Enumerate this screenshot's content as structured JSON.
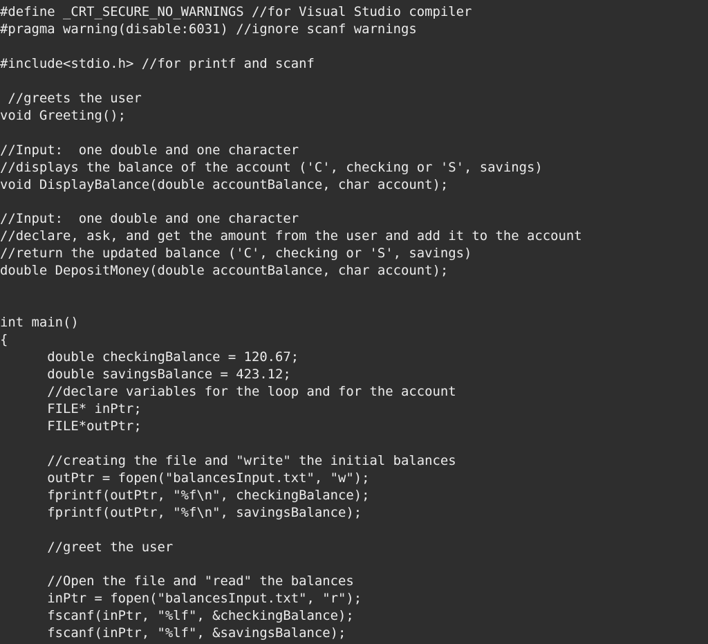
{
  "editor": {
    "background_color": "#2e2e2e",
    "text_color": "#ececec",
    "language": "c",
    "filename_hint": "main.c"
  },
  "code": {
    "full_text": "#define _CRT_SECURE_NO_WARNINGS //for Visual Studio compiler\n#pragma warning(disable:6031) //ignore scanf warnings\n\n#include<stdio.h> //for printf and scanf\n\n //greets the user\nvoid Greeting();\n\n//Input:  one double and one character\n//displays the balance of the account ('C', checking or 'S', savings)\nvoid DisplayBalance(double accountBalance, char account);\n\n//Input:  one double and one character\n//declare, ask, and get the amount from the user and add it to the account\n//return the updated balance ('C', checking or 'S', savings)\ndouble DepositMoney(double accountBalance, char account);\n\n\nint main()\n{\n      double checkingBalance = 120.67;\n      double savingsBalance = 423.12;\n      //declare variables for the loop and for the account\n      FILE* inPtr;\n      FILE*outPtr;\n\n      //creating the file and \"write\" the initial balances\n      outPtr = fopen(\"balancesInput.txt\", \"w\");\n      fprintf(outPtr, \"%f\\n\", checkingBalance);\n      fprintf(outPtr, \"%f\\n\", savingsBalance);\n\n      //greet the user\n\n      //Open the file and \"read\" the balances\n      inPtr = fopen(\"balancesInput.txt\", \"r\");\n      fscanf(inPtr, \"%lf\", &checkingBalance);\n      fscanf(inPtr, \"%lf\", &savingsBalance);",
    "lines": [
      "#define _CRT_SECURE_NO_WARNINGS //for Visual Studio compiler",
      "#pragma warning(disable:6031) //ignore scanf warnings",
      "",
      "#include<stdio.h> //for printf and scanf",
      "",
      " //greets the user",
      "void Greeting();",
      "",
      "//Input:  one double and one character",
      "//displays the balance of the account ('C', checking or 'S', savings)",
      "void DisplayBalance(double accountBalance, char account);",
      "",
      "//Input:  one double and one character",
      "//declare, ask, and get the amount from the user and add it to the account",
      "//return the updated balance ('C', checking or 'S', savings)",
      "double DepositMoney(double accountBalance, char account);",
      "",
      "",
      "int main()",
      "{",
      "      double checkingBalance = 120.67;",
      "      double savingsBalance = 423.12;",
      "      //declare variables for the loop and for the account",
      "      FILE* inPtr;",
      "      FILE*outPtr;",
      "",
      "      //creating the file and \"write\" the initial balances",
      "      outPtr = fopen(\"balancesInput.txt\", \"w\");",
      "      fprintf(outPtr, \"%f\\n\", checkingBalance);",
      "      fprintf(outPtr, \"%f\\n\", savingsBalance);",
      "",
      "      //greet the user",
      "",
      "      //Open the file and \"read\" the balances",
      "      inPtr = fopen(\"balancesInput.txt\", \"r\");",
      "      fscanf(inPtr, \"%lf\", &checkingBalance);",
      "      fscanf(inPtr, \"%lf\", &savingsBalance);"
    ],
    "values": {
      "checking_balance": "120.67",
      "savings_balance": "423.12",
      "input_filename": "balancesInput.txt",
      "write_mode": "w",
      "read_mode": "r",
      "fprintf_format": "%f\\n",
      "fscanf_format": "%lf",
      "pragma_warning_code": "6031",
      "include_header": "stdio.h",
      "define_macro": "_CRT_SECURE_NO_WARNINGS"
    },
    "functions": [
      "void Greeting();",
      "void DisplayBalance(double accountBalance, char account);",
      "double DepositMoney(double accountBalance, char account);",
      "int main()"
    ]
  }
}
